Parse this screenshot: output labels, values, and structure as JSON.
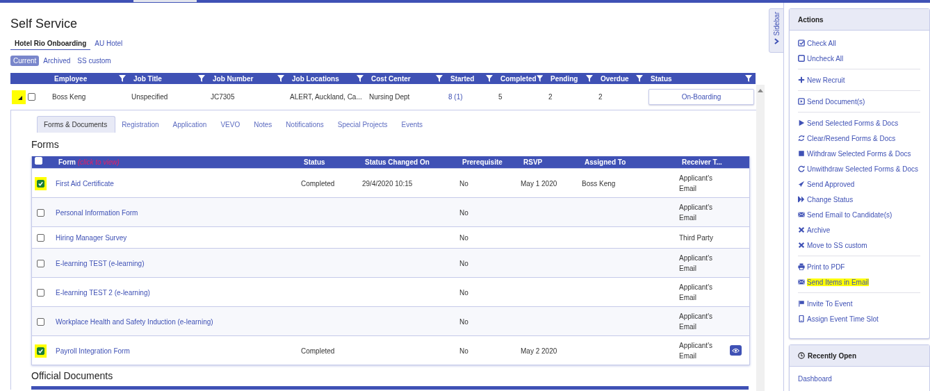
{
  "page_title": "Self Service",
  "tabs": [
    {
      "label": "Hotel Rio Onboarding",
      "selected": true
    },
    {
      "label": "AU Hotel",
      "selected": false
    }
  ],
  "filters": [
    {
      "label": "Current",
      "selected": true
    },
    {
      "label": "Archived",
      "selected": false
    },
    {
      "label": "SS custom",
      "selected": false
    }
  ],
  "employee_table": {
    "columns": [
      "Employee",
      "Job Title",
      "Job Number",
      "Job Locations",
      "Cost Center",
      "Started",
      "Completed",
      "Pending",
      "Overdue",
      "Status"
    ],
    "rows": [
      {
        "expanded": true,
        "toggle_highlighted": true,
        "checked": false,
        "employee": "Boss Keng",
        "job_title": "Unspecified",
        "job_number": "JC7305",
        "job_locations": "ALERT, Auckland, Ca...",
        "cost_center": "Nursing Dept",
        "started": "8 (1)",
        "completed": "5",
        "pending": "2",
        "overdue": "2",
        "status": "On-Boarding"
      }
    ]
  },
  "detail_tabs": [
    {
      "label": "Forms & Documents",
      "selected": true
    },
    {
      "label": "Registration",
      "selected": false
    },
    {
      "label": "Application",
      "selected": false
    },
    {
      "label": "VEVO",
      "selected": false
    },
    {
      "label": "Notes",
      "selected": false
    },
    {
      "label": "Notifications",
      "selected": false
    },
    {
      "label": "Special Projects",
      "selected": false
    },
    {
      "label": "Events",
      "selected": false
    }
  ],
  "forms": {
    "title": "Forms",
    "select_all_checked": false,
    "columns": [
      "Form",
      "Status",
      "Status Changed On",
      "Prerequisite",
      "RSVP",
      "Assigned To",
      "Receiver T..."
    ],
    "form_hint": "(click to view)",
    "rows": [
      {
        "checked": true,
        "highlighted": true,
        "form": "First Aid Certificate",
        "status": "Completed",
        "changed_on": "29/4/2020 10:15",
        "prerequisite": "No",
        "rsvp": "May 1 2020",
        "assigned_to": "Boss Keng",
        "receiver": "Applicant's Email",
        "viewable": false
      },
      {
        "checked": false,
        "highlighted": false,
        "form": "Personal Information Form",
        "status": "",
        "changed_on": "",
        "prerequisite": "No",
        "rsvp": "",
        "assigned_to": "",
        "receiver": "Applicant's Email",
        "viewable": false
      },
      {
        "checked": false,
        "highlighted": false,
        "form": "Hiring Manager Survey",
        "status": "",
        "changed_on": "",
        "prerequisite": "No",
        "rsvp": "",
        "assigned_to": "",
        "receiver": "Third Party",
        "viewable": false
      },
      {
        "checked": false,
        "highlighted": false,
        "form": "E-learning TEST (e-learning)",
        "status": "",
        "changed_on": "",
        "prerequisite": "No",
        "rsvp": "",
        "assigned_to": "",
        "receiver": "Applicant's Email",
        "viewable": false
      },
      {
        "checked": false,
        "highlighted": false,
        "form": "E-learning TEST 2 (e-learning)",
        "status": "",
        "changed_on": "",
        "prerequisite": "No",
        "rsvp": "",
        "assigned_to": "",
        "receiver": "Applicant's Email",
        "viewable": false
      },
      {
        "checked": false,
        "highlighted": false,
        "form": "Workplace Health and Safety Induction (e-learning)",
        "status": "",
        "changed_on": "",
        "prerequisite": "No",
        "rsvp": "",
        "assigned_to": "",
        "receiver": "Applicant's Email",
        "viewable": false
      },
      {
        "checked": true,
        "highlighted": true,
        "form": "Payroll Integration Form",
        "status": "Completed",
        "changed_on": "",
        "prerequisite": "No",
        "rsvp": "May 2 2020",
        "assigned_to": "",
        "receiver": "Applicant's Email",
        "viewable": true
      }
    ]
  },
  "documents_title": "Official Documents",
  "sidebar_tab": "Sidebar",
  "actions": {
    "title": "Actions",
    "groups": [
      [
        {
          "label": "Check All",
          "kind": "check-square",
          "highlighted": false
        },
        {
          "label": "Uncheck All",
          "kind": "square",
          "highlighted": false
        }
      ],
      [
        {
          "label": "New Recruit",
          "kind": "plus",
          "highlighted": false
        }
      ],
      [
        {
          "label": "Send Document(s)",
          "kind": "play-square",
          "highlighted": false
        }
      ],
      [
        {
          "label": "Send Selected Forms & Docs",
          "kind": "play",
          "highlighted": false
        },
        {
          "label": "Clear/Resend Forms & Docs",
          "kind": "refresh",
          "highlighted": false
        },
        {
          "label": "Withdraw Selected Forms & Docs",
          "kind": "stop",
          "highlighted": false
        },
        {
          "label": "Unwithdraw Selected Forms & Docs",
          "kind": "redo",
          "highlighted": false
        },
        {
          "label": "Send Approved",
          "kind": "send",
          "highlighted": false
        },
        {
          "label": "Change Status",
          "kind": "forward",
          "highlighted": false
        },
        {
          "label": "Send Email to Candidate(s)",
          "kind": "envelope",
          "highlighted": false
        },
        {
          "label": "Archive",
          "kind": "cross",
          "highlighted": false
        },
        {
          "label": "Move to SS custom",
          "kind": "cross",
          "highlighted": false
        }
      ],
      [
        {
          "label": "Print to PDF",
          "kind": "print",
          "highlighted": false
        },
        {
          "label": "Send Items in Email",
          "kind": "envelope",
          "highlighted": true
        }
      ],
      [
        {
          "label": "Invite To Event",
          "kind": "flag",
          "highlighted": false
        },
        {
          "label": "Assign Event Time Slot",
          "kind": "mobile",
          "highlighted": false
        }
      ]
    ]
  },
  "recently_open": {
    "title": "Recently Open",
    "items": [
      "Dashboard"
    ]
  }
}
